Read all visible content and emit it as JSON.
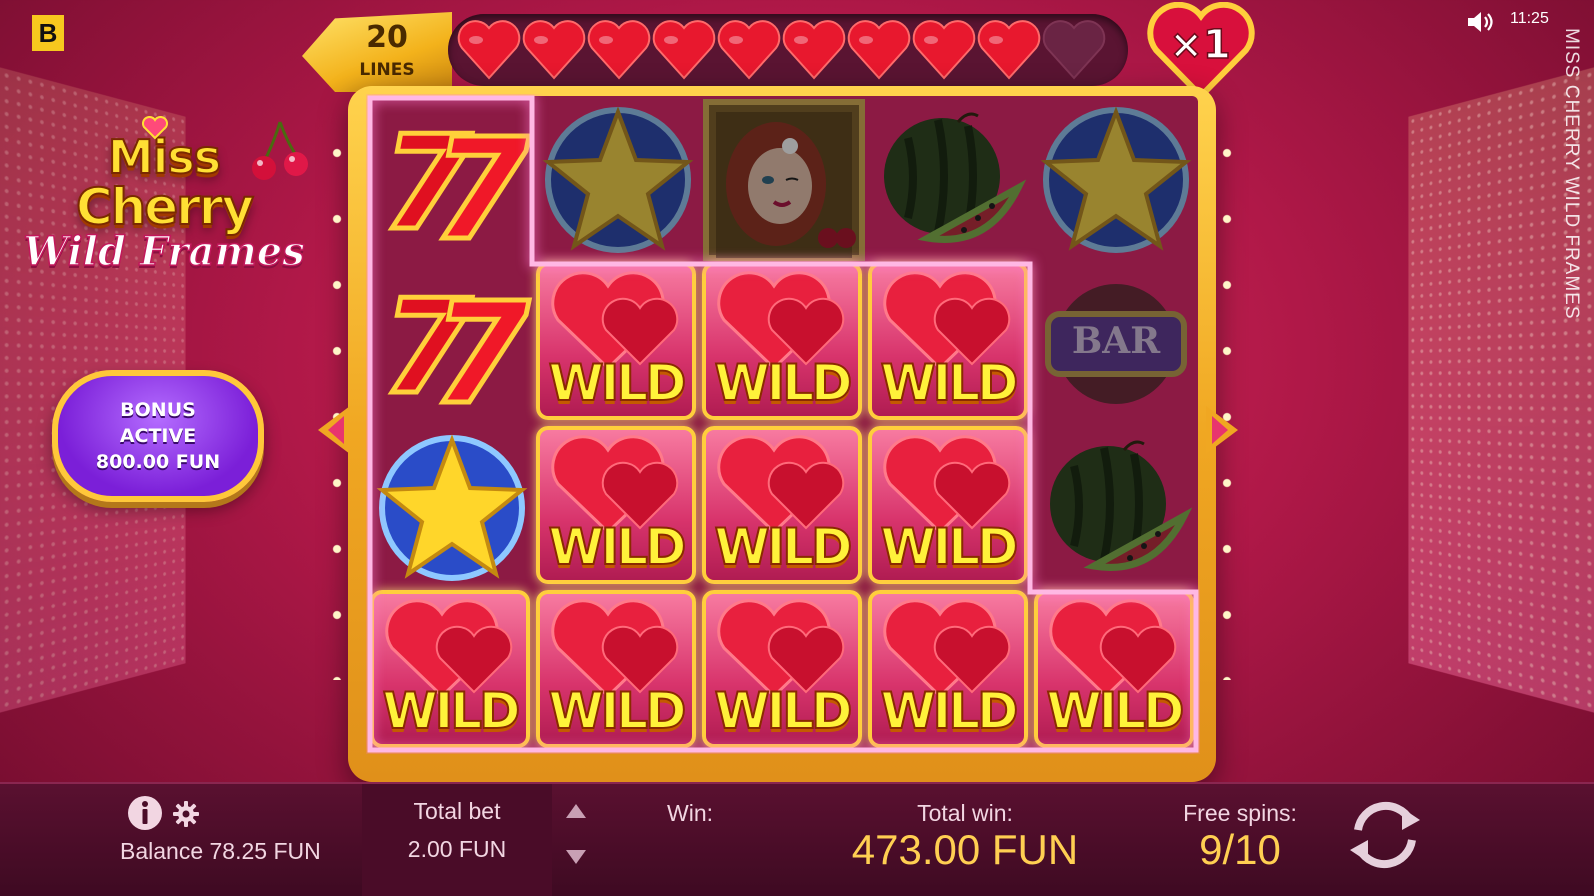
{
  "top": {
    "brand_letter": "B",
    "clock": "11:25",
    "vertical_title": "MISS CHERRY WILD FRAMES"
  },
  "logo": {
    "line1": "Miss",
    "line2": "Cherry",
    "line3": "Wild Frames"
  },
  "bonus": {
    "line1": "BONUS",
    "line2": "ACTIVE",
    "line3": "800.00 FUN"
  },
  "lines": {
    "count": "20",
    "label": "LINES"
  },
  "hearts_meter": {
    "filled": 9,
    "total": 10
  },
  "multiplier": "×1",
  "wild_label": "WILD",
  "bar_label": "BAR",
  "reels": [
    [
      "sevens",
      "sevens",
      "star",
      "wild"
    ],
    [
      "star",
      "wild",
      "wild",
      "wild"
    ],
    [
      "lady",
      "wild",
      "wild",
      "wild"
    ],
    [
      "watermelon",
      "wild",
      "wild",
      "wild"
    ],
    [
      "star",
      "bar",
      "watermelon",
      "wild"
    ]
  ],
  "bottom": {
    "balance": "Balance 78.25 FUN",
    "total_bet_label": "Total bet",
    "total_bet_value": "2.00 FUN",
    "win_label": "Win:",
    "total_win_label": "Total win:",
    "total_win_value": "473.00 FUN",
    "free_spins_label": "Free spins:",
    "free_spins_value": "9/10"
  },
  "colors": {
    "accent_gold": "#ffcf52",
    "bonus_purple": "#7b1fd8",
    "frame_gold": "#f0a722"
  }
}
